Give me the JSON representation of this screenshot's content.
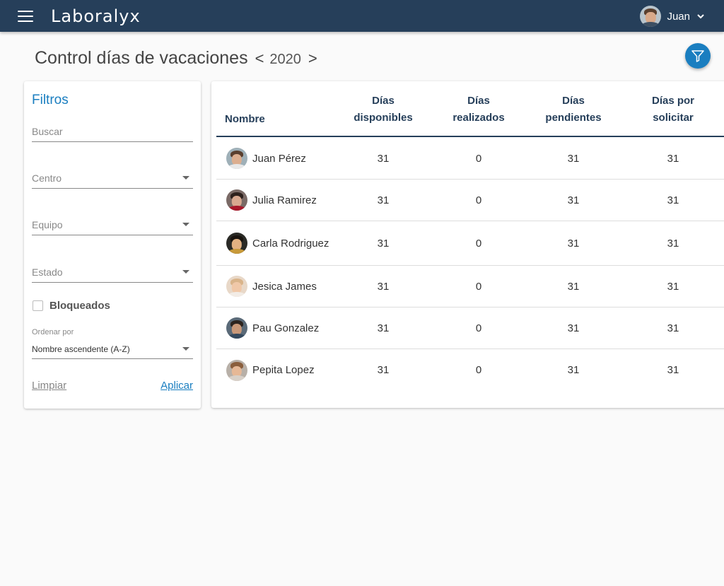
{
  "app": {
    "brand": "Laboralyx",
    "user": {
      "name": "Juan"
    }
  },
  "page": {
    "title": "Control días de vacaciones",
    "year_prev": "<",
    "year": "2020",
    "year_next": ">"
  },
  "filters": {
    "title": "Filtros",
    "search_placeholder": "Buscar",
    "centro_placeholder": "Centro",
    "equipo_placeholder": "Equipo",
    "estado_placeholder": "Estado",
    "blocked_label": "Bloqueados",
    "blocked_checked": false,
    "order_label": "Ordenar por",
    "order_value": "Nombre ascendente (A-Z)",
    "clear_label": "Limpiar",
    "apply_label": "Aplicar"
  },
  "table": {
    "columns": {
      "name": "Nombre",
      "available_1": "Días",
      "available_2": "disponibles",
      "done_1": "Días",
      "done_2": "realizados",
      "pending_1": "Días",
      "pending_2": "pendientes",
      "to_request_1": "Días por",
      "to_request_2": "solicitar"
    },
    "rows": [
      {
        "name": "Juan Pérez",
        "available": "31",
        "done": "0",
        "pending": "31",
        "to_request": "31"
      },
      {
        "name": "Julia Ramirez",
        "available": "31",
        "done": "0",
        "pending": "31",
        "to_request": "31"
      },
      {
        "name": "Carla Rodriguez",
        "available": "31",
        "done": "0",
        "pending": "31",
        "to_request": "31"
      },
      {
        "name": "Jesica James",
        "available": "31",
        "done": "0",
        "pending": "31",
        "to_request": "31"
      },
      {
        "name": "Pau Gonzalez",
        "available": "31",
        "done": "0",
        "pending": "31",
        "to_request": "31"
      },
      {
        "name": "Pepita Lopez",
        "available": "31",
        "done": "0",
        "pending": "31",
        "to_request": "31"
      }
    ]
  },
  "colors": {
    "topbar": "#263f5a",
    "accent": "#1a7ec0",
    "header_text": "#263f5a"
  },
  "icons": {
    "menu": "hamburger-menu-icon",
    "filter": "filter-funnel-icon",
    "user_dropdown": "chevron-down-icon",
    "select_caret": "caret-down-icon"
  }
}
